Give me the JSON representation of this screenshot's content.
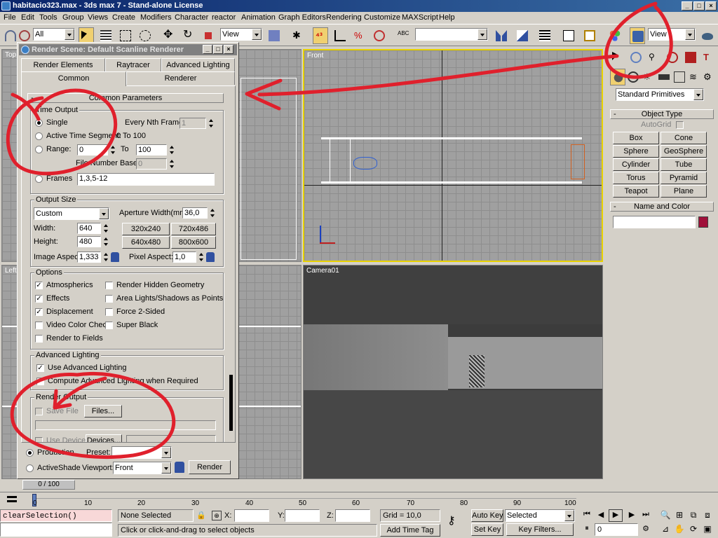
{
  "window": {
    "title": "habitacio323.max - 3ds max 7  - Stand-alone License"
  },
  "menu": [
    "File",
    "Edit",
    "Tools",
    "Group",
    "Views",
    "Create",
    "Modifiers",
    "Character",
    "reactor",
    "Animation",
    "Graph Editors",
    "Rendering",
    "Customize",
    "MAXScript",
    "Help"
  ],
  "toolbar": {
    "selection_filter": "All",
    "ref_coord": "View",
    "named_sel": "",
    "render_view": "View"
  },
  "viewports": {
    "top_left": "Top",
    "front": "Front",
    "left": "Left",
    "camera": "Camera01"
  },
  "command_panel": {
    "category": "Standard Primitives",
    "object_type_header": "Object Type",
    "autogrid": "AutoGrid",
    "buttons": [
      "Box",
      "Cone",
      "Sphere",
      "GeoSphere",
      "Cylinder",
      "Tube",
      "Torus",
      "Pyramid",
      "Teapot",
      "Plane"
    ],
    "name_color_header": "Name and Color",
    "name_value": "",
    "object_color": "#a0103a"
  },
  "render_dialog": {
    "title": "Render Scene: Default Scanline Renderer",
    "tabs_row1": [
      "Render Elements",
      "Raytracer",
      "Advanced Lighting"
    ],
    "tabs_row2": [
      "Common",
      "Renderer"
    ],
    "rollout": "Common Parameters",
    "time_output": {
      "label": "Time Output",
      "single": "Single",
      "every_nth": "Every Nth Frame:",
      "every_nth_value": "1",
      "active_segment": "Active Time Segment:",
      "active_segment_value": "0 To 100",
      "range": "Range:",
      "range_from": "0",
      "range_to_label": "To",
      "range_to": "100",
      "file_number_base": "File Number Base:",
      "file_number_base_value": "0",
      "frames": "Frames",
      "frames_value": "1,3,5-12"
    },
    "output_size": {
      "label": "Output Size",
      "preset": "Custom",
      "aperture": "Aperture Width(mm):",
      "aperture_value": "36,0",
      "width_label": "Width:",
      "width": "640",
      "height_label": "Height:",
      "height": "480",
      "presets": [
        "320x240",
        "720x486",
        "640x480",
        "800x600"
      ],
      "image_aspect": "Image Aspect:",
      "image_aspect_value": "1,333",
      "pixel_aspect": "Pixel Aspect:",
      "pixel_aspect_value": "1,0"
    },
    "options": {
      "label": "Options",
      "atmospherics": "Atmospherics",
      "render_hidden": "Render Hidden Geometry",
      "effects": "Effects",
      "area_lights": "Area Lights/Shadows as Points",
      "displacement": "Displacement",
      "force_2sided": "Force 2-Sided",
      "video_color": "Video Color Check",
      "super_black": "Super Black",
      "render_fields": "Render to Fields"
    },
    "advanced_lighting": {
      "label": "Advanced Lighting",
      "use": "Use Advanced Lighting",
      "compute": "Compute Advanced Lighting when Required"
    },
    "render_output": {
      "label": "Render Output",
      "save_file": "Save File",
      "files_btn": "Files...",
      "use_device": "Use Device",
      "devices_btn": "Devices..."
    },
    "bottom": {
      "production": "Production",
      "preset_label": "Preset:",
      "activeshade": "ActiveShade",
      "viewport_label": "Viewport:",
      "viewport_value": "Front",
      "render_btn": "Render"
    }
  },
  "timeline": {
    "frame_counter": "0 / 100",
    "ticks": [
      "0",
      "10",
      "20",
      "30",
      "40",
      "50",
      "60",
      "70",
      "80",
      "90",
      "100"
    ]
  },
  "status": {
    "maxscript": "clearSelection()",
    "selection": "None Selected",
    "x_label": "X:",
    "y_label": "Y:",
    "z_label": "Z:",
    "grid": "Grid = 10,0",
    "prompt": "Click or click-and-drag to select objects",
    "add_time_tag": "Add Time Tag",
    "auto_key": "Auto Key",
    "set_key": "Set Key",
    "key_mode": "Selected",
    "key_filters": "Key Filters...",
    "frame": "0"
  }
}
